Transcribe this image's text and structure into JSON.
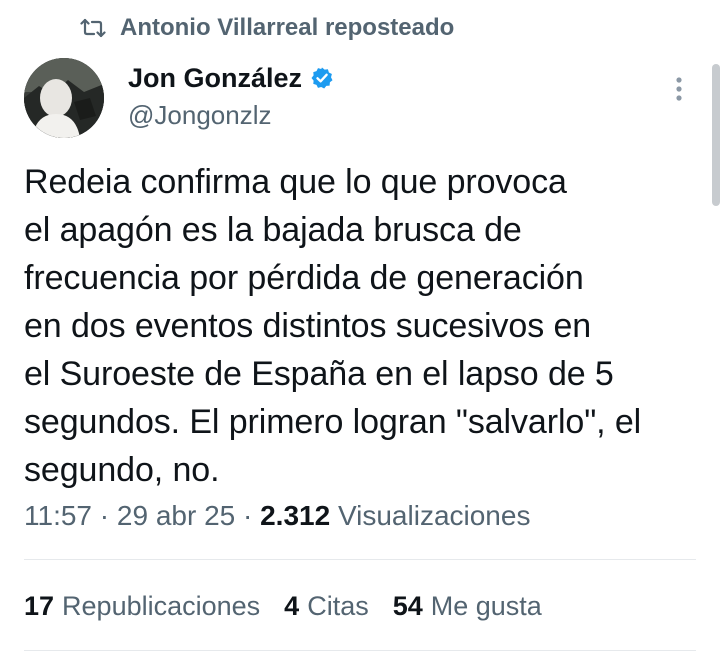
{
  "repost": {
    "icon": "repost-icon",
    "label": "Antonio Villarreal reposteado"
  },
  "author": {
    "avatar_icon": "avatar",
    "name": "Jon González",
    "verified_icon": "verified-badge-icon",
    "handle": "@Jongonzlz"
  },
  "more_icon": "more-options-icon",
  "tweet": {
    "text": "Redeia confirma que lo que provoca\nel apagón es la bajada brusca de\nfrecuencia por pérdida de generación\nen dos eventos distintos sucesivos en\nel Suroeste de España en el lapso de 5\nsegundos. El primero logran \"salvarlo\", el\nsegundo, no."
  },
  "meta": {
    "time": "11:57",
    "separator": "·",
    "date": "29 abr 25",
    "views_count": "2.312",
    "views_label": "Visualizaciones"
  },
  "stats": {
    "reposts_count": "17",
    "reposts_label": "Republicaciones",
    "quotes_count": "4",
    "quotes_label": "Citas",
    "likes_count": "54",
    "likes_label": "Me gusta"
  },
  "colors": {
    "primary_text": "#0f1419",
    "secondary_text": "#536471",
    "verified_blue": "#1d9bf0",
    "divider": "#e6e9ec"
  }
}
